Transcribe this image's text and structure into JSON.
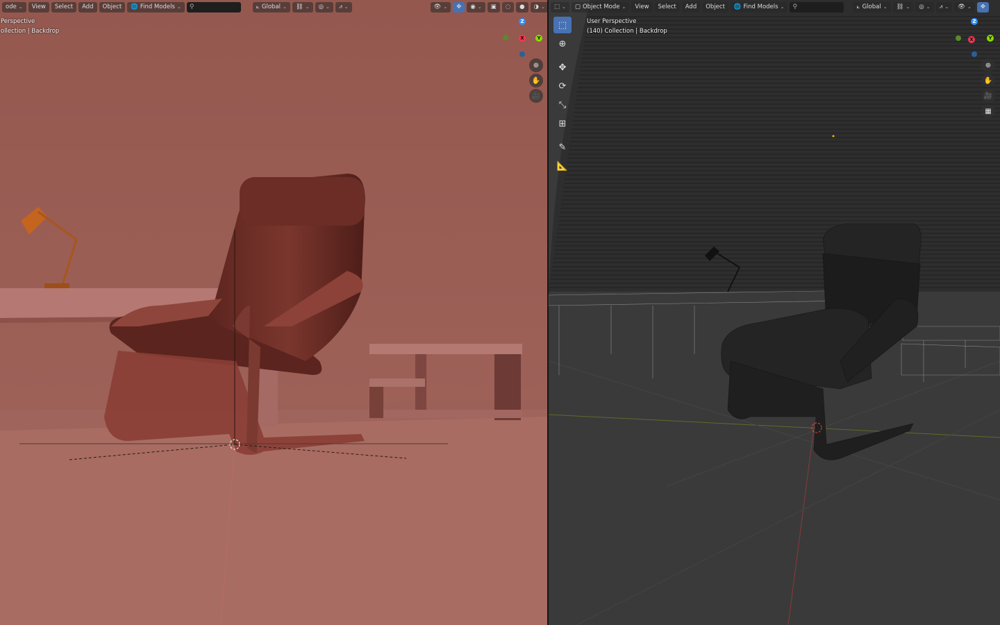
{
  "left_viewport": {
    "header": {
      "mode_label": "ode",
      "menu": [
        "View",
        "Select",
        "Add",
        "Object"
      ],
      "find_models_label": "Find Models",
      "search_placeholder": "",
      "transform_orientation": "Global"
    },
    "overlay": {
      "view_name": "Perspective",
      "collection_label": "ollection | Backdrop"
    },
    "gizmo": {
      "z": "Z",
      "x": "X",
      "y": "Y"
    },
    "colors": {
      "background": "#9b5e57",
      "floor": "#a86c62",
      "chair": "#6a2b24"
    }
  },
  "right_viewport": {
    "header": {
      "mode_label": "Object Mode",
      "menu": [
        "View",
        "Select",
        "Add",
        "Object"
      ],
      "find_models_label": "Find Models",
      "search_placeholder": "",
      "transform_orientation": "Global"
    },
    "overlay": {
      "view_name": "User Perspective",
      "collection_label": "(140) Collection | Backdrop"
    },
    "gizmo": {
      "z": "Z",
      "x": "X",
      "y": "Y"
    },
    "toolbar": [
      "select-box-tool",
      "cursor-tool",
      "move-tool",
      "rotate-tool",
      "scale-tool",
      "transform-tool",
      "annotate-tool",
      "measure-tool"
    ],
    "colors": {
      "background": "#3a3a3a",
      "accent": "#4772b3"
    }
  }
}
